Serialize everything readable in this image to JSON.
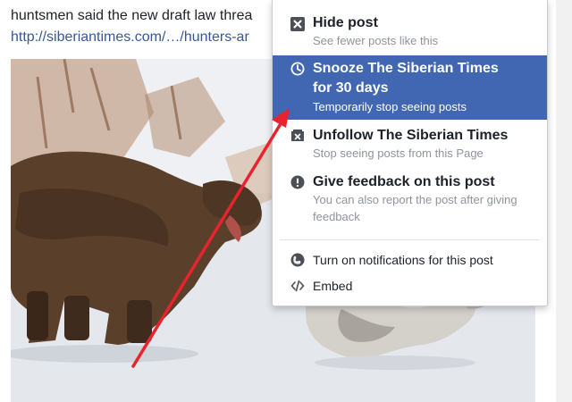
{
  "post": {
    "text_line1": "",
    "text_line2": "huntsmen said the new draft law threa",
    "link": "http://siberiantimes.com/…/hunters-ar"
  },
  "menu": {
    "hide": {
      "title": "Hide post",
      "subtitle": "See fewer posts like this",
      "icon": "hide-x-icon"
    },
    "snooze": {
      "title_line1": "Snooze The Siberian Times",
      "title_line2": "for 30 days",
      "subtitle": "Temporarily stop seeing posts",
      "icon": "clock-icon"
    },
    "unfollow": {
      "title": "Unfollow The Siberian Times",
      "subtitle": "Stop seeing posts from this Page",
      "icon": "unfollow-icon"
    },
    "feedback": {
      "title": "Give feedback on this post",
      "subtitle_line1": "You can also report the post after giving",
      "subtitle_line2": "feedback",
      "icon": "alert-icon"
    },
    "notifications": {
      "label": "Turn on notifications for this post",
      "icon": "globe-icon"
    },
    "embed": {
      "label": "Embed",
      "icon": "code-icon"
    }
  },
  "colors": {
    "selected_bg": "#4267b2",
    "link": "#365899",
    "arrow": "#e8232d"
  }
}
